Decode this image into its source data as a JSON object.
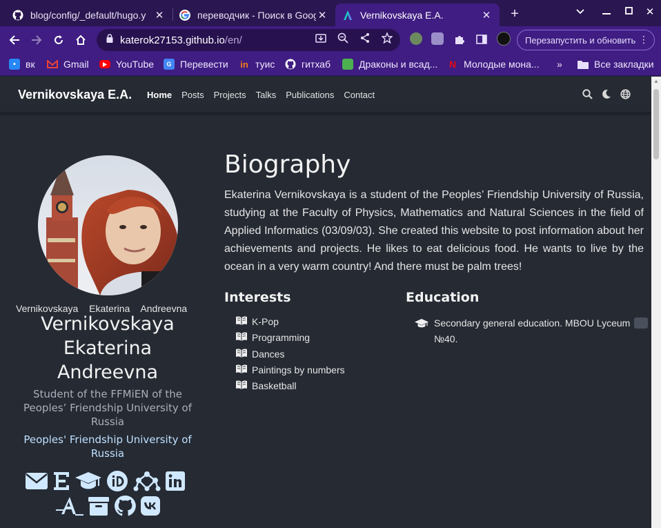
{
  "browser": {
    "tabs": [
      {
        "title": "blog/config/_default/hugo.y",
        "icon": "github-icon"
      },
      {
        "title": "переводчик - Поиск в Goog",
        "icon": "google-icon"
      },
      {
        "title": "Vernikovskaya E.A.",
        "icon": "site-icon",
        "active": true
      }
    ],
    "url_host": "katerok27153.github.io",
    "url_path": "/en/",
    "relaunch_label": "Перезапустить и обновить",
    "bookmarks": [
      {
        "label": "вк",
        "icon": "vk-icon",
        "color": "#2787f5"
      },
      {
        "label": "Gmail",
        "icon": "gmail-icon",
        "color": "#ea4335"
      },
      {
        "label": "YouTube",
        "icon": "youtube-icon",
        "color": "#ff0000"
      },
      {
        "label": "Перевести",
        "icon": "translate-icon",
        "color": "#4285f4"
      },
      {
        "label": "туис",
        "icon": "tuis-icon",
        "color": "#f07a1a"
      },
      {
        "label": "гитхаб",
        "icon": "github-icon",
        "color": "#ffffff"
      },
      {
        "label": "Драконы и всад...",
        "icon": "dragon-icon",
        "color": "#4caf50"
      },
      {
        "label": "Молодые мона...",
        "icon": "netflix-icon",
        "color": "#e50914"
      }
    ],
    "all_bookmarks_label": "Все закладки"
  },
  "site": {
    "brand": "Vernikovskaya E.A.",
    "menu": [
      "Home",
      "Posts",
      "Projects",
      "Talks",
      "Publications",
      "Contact"
    ],
    "active_menu": "Home"
  },
  "profile": {
    "alt_name": "Vernikovskaya Ekaterina Andreevna",
    "name": "Vernikovskaya Ekaterina Andreevna",
    "role": "Student of the FFMiEN of the Peoples’ Friendship University of Russia",
    "organization": "Peoples' Friendship University of Russia",
    "social": [
      "email-icon",
      "e-library-icon",
      "graduation-cap-icon",
      "orcid-icon",
      "researchgate-icon",
      "linkedin-icon",
      "academia-icon",
      "archive-icon",
      "github-icon",
      "vk-icon"
    ]
  },
  "biography": {
    "title": "Biography",
    "text": "Ekaterina Vernikovskaya is a student of the Peoples’ Friendship University of Russia, studying at the Faculty of Physics, Mathematics and Natural Sciences in the field of Applied Informatics (03/09/03). She created this website to post information about her achievements and projects. He likes to eat delicious food. He wants to live by the ocean in a very warm country! And there must be palm trees!",
    "interests_title": "Interests",
    "interests": [
      "K-Pop",
      "Programming",
      "Dances",
      "Paintings by numbers",
      "Basketball"
    ],
    "education_title": "Education",
    "education": [
      "Secondary general education. MBOU Lyceum №40."
    ]
  }
}
